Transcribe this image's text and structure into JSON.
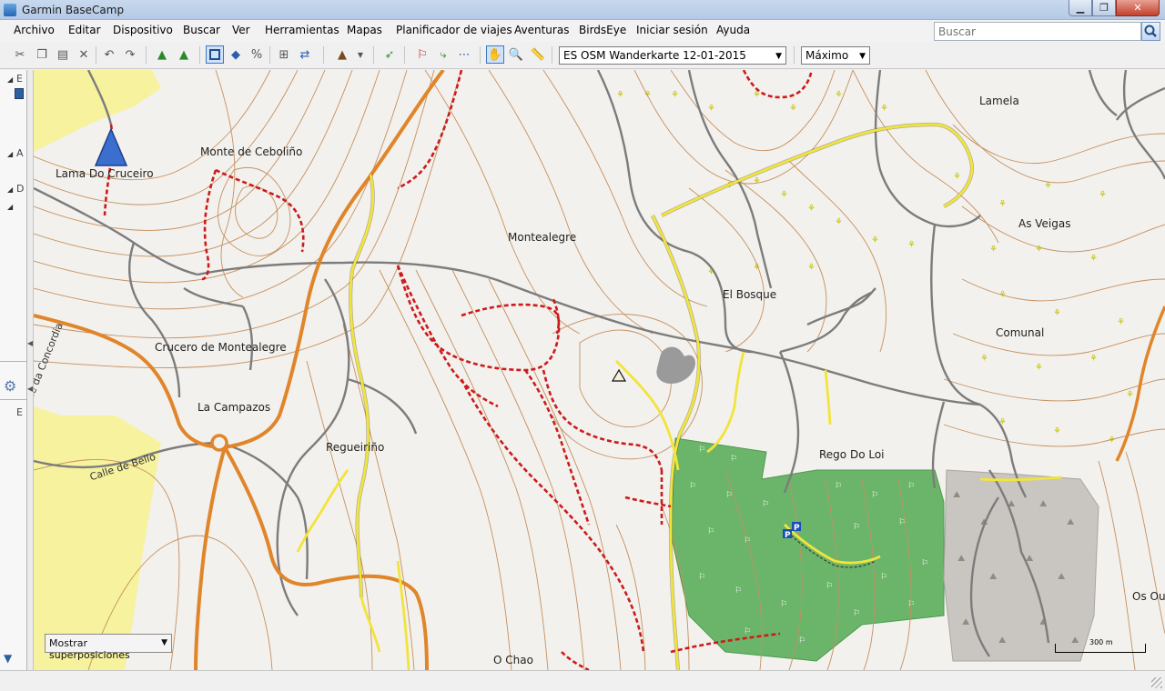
{
  "window": {
    "title": "Garmin BaseCamp"
  },
  "menu": {
    "items": [
      "Archivo",
      "Editar",
      "Dispositivo",
      "Buscar",
      "Ver",
      "Herramientas",
      "Mapas",
      "Planificador de viajes",
      "Aventuras",
      "BirdsEye",
      "Iniciar sesión",
      "Ayuda"
    ]
  },
  "search": {
    "placeholder": "Buscar"
  },
  "toolbar": {
    "map_product": "ES OSM Wanderkarte 12-01-2015",
    "detail_level": "Máximo"
  },
  "left_pane": {
    "section_letters": [
      "E",
      "A",
      "D",
      "E"
    ]
  },
  "map": {
    "place_labels": [
      "Lamela",
      "Monte de Ceboliño",
      "Lama Do Cruceiro",
      "As Veigas",
      "Montealegre",
      "El Bosque",
      "Comunal",
      "Crucero de Montealegre",
      "La Campazos",
      "Regueiriño",
      "Rego Do Loi",
      "O Chao",
      "Os Out"
    ],
    "street_labels": [
      "Calle da Concordia",
      "Calle de Bello"
    ],
    "overlay_dropdown": "Mostrar superposiciones",
    "scale": "300 m",
    "colors": {
      "background": "#f3f1ed",
      "contour": "#c49060",
      "main_road": "#e08a2a",
      "secondary_road": "#f0e23c",
      "minor_road": "#8a8a8a",
      "trail": "#d01a1a",
      "forest": "#6ab56a",
      "scrub": "#f4f09a",
      "quarry": "#c8c4c0"
    }
  }
}
